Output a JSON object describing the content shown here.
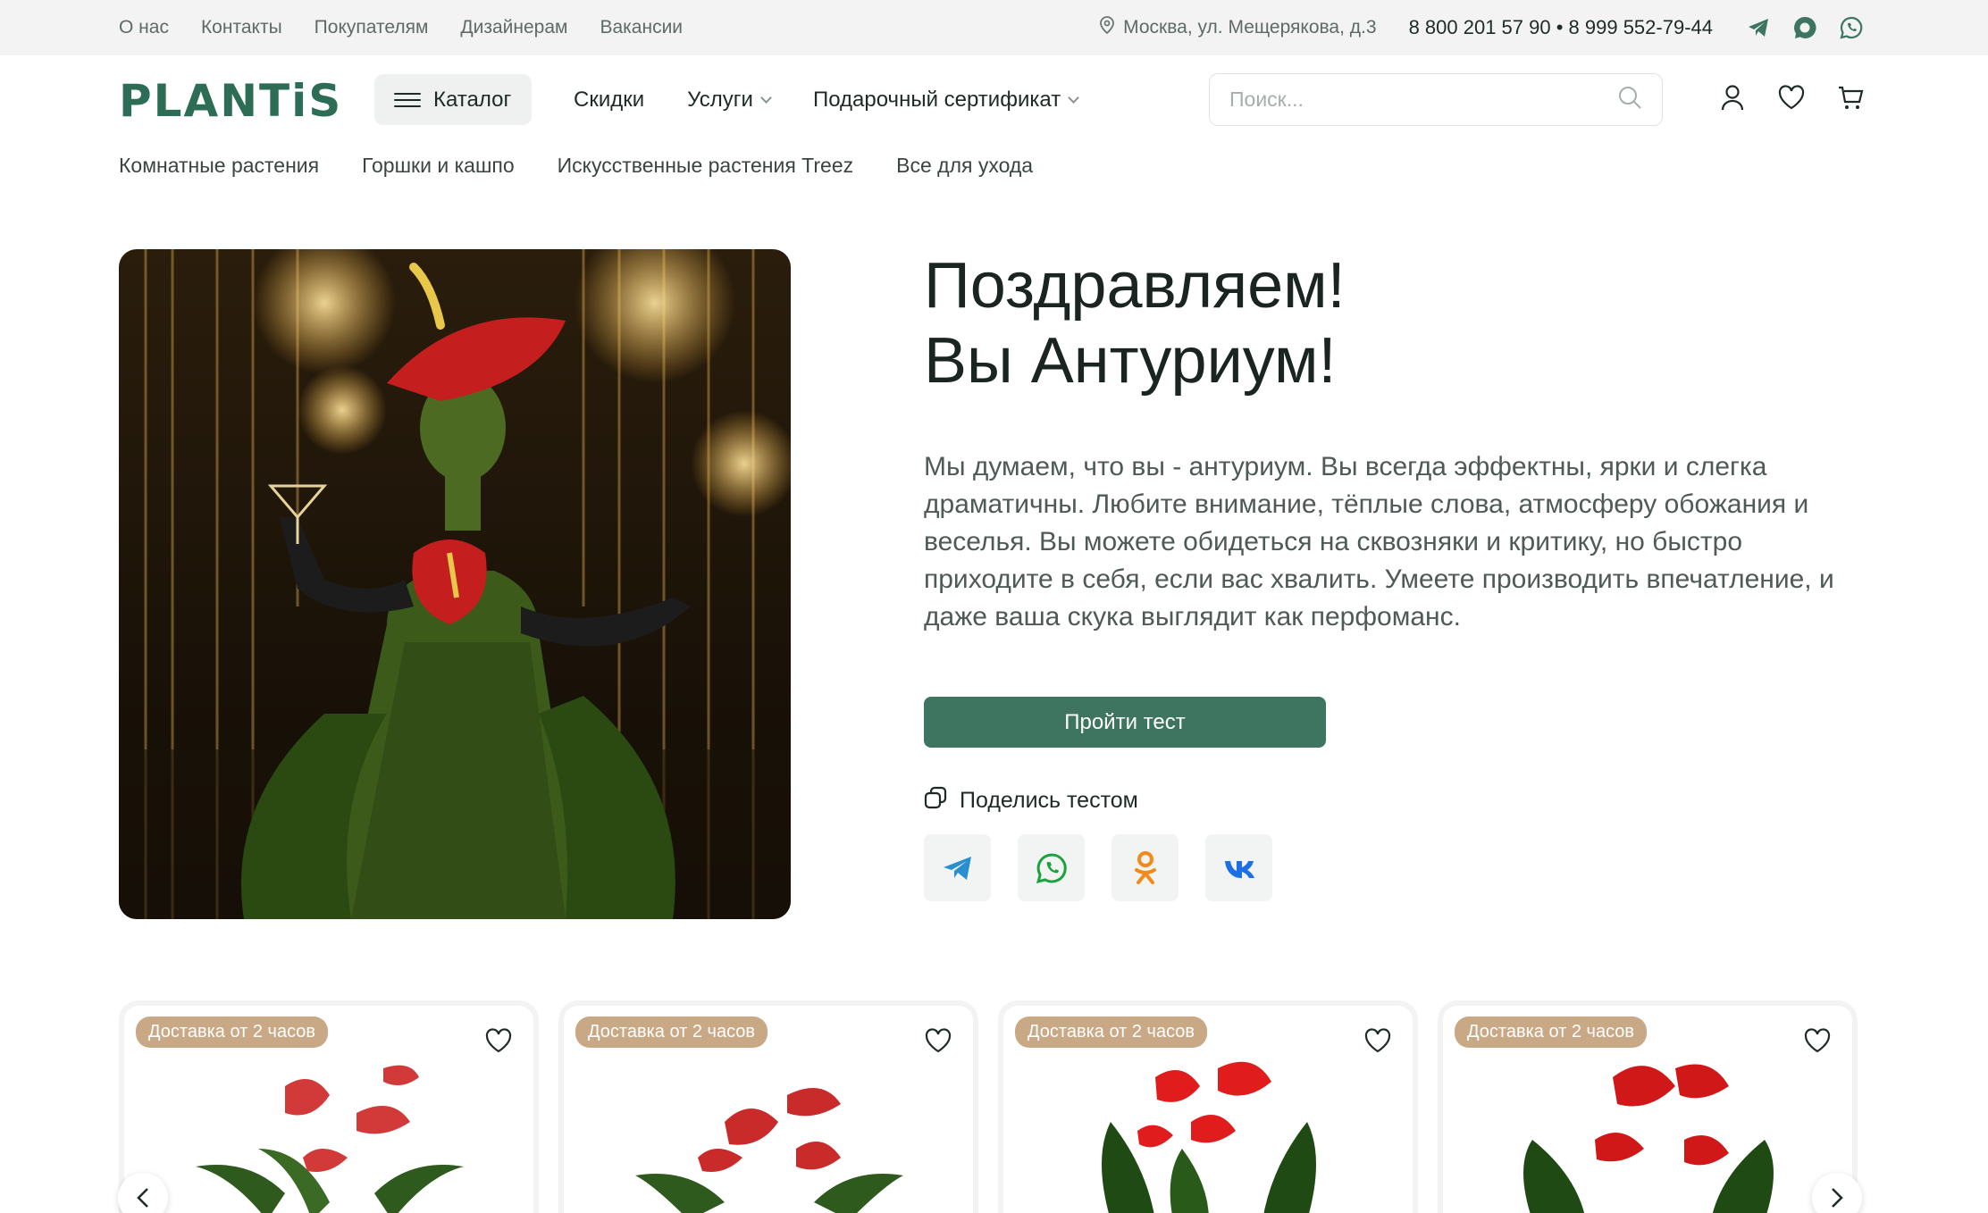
{
  "topbar": {
    "links": [
      "О нас",
      "Контакты",
      "Покупателям",
      "Дизайнерам",
      "Вакансии"
    ],
    "address": "Москва, ул. Мещерякова, д.3",
    "phones": "8 800 201 57 90 • 8 999 552-79-44",
    "messengers": [
      "telegram-icon",
      "max-icon",
      "whatsapp-icon"
    ]
  },
  "header": {
    "logo": "PLANTiS",
    "catalog_label": "Каталог",
    "nav": {
      "discounts": "Скидки",
      "services": "Услуги",
      "gift": "Подарочный сертификат"
    },
    "search_placeholder": "Поиск..."
  },
  "subnav": [
    "Комнатные растения",
    "Горшки и кашпо",
    "Искусственные растения Treez",
    "Все для ухода"
  ],
  "hero": {
    "title_line1": "Поздравляем!",
    "title_line2": "Вы Антуриум!",
    "text": "Мы думаем, что вы - антуриум. Вы всегда эффектны, ярки и слегка драматичны. Любите внимание, тёплые слова, атмосферу обожания и веселья. Вы можете обидеться на сквозняки и критику, но быстро приходите в себя, если вас хвалить. Умеете производить впечатление, и даже ваша скука выглядит как перфоманс.",
    "button": "Пройти тест",
    "share_label": "Поделись тестом",
    "socials": [
      "telegram-icon",
      "whatsapp-icon",
      "odnoklassniki-icon",
      "vk-icon"
    ]
  },
  "products": [
    {
      "badge": "Доставка от 2 часов"
    },
    {
      "badge": "Доставка от 2 часов"
    },
    {
      "badge": "Доставка от 2 часов"
    },
    {
      "badge": "Доставка от 2 часов"
    }
  ],
  "colors": {
    "brand": "#2e6d55",
    "button": "#3d7560",
    "badge": "#c9a886",
    "topbar": "#f2f3f2"
  }
}
